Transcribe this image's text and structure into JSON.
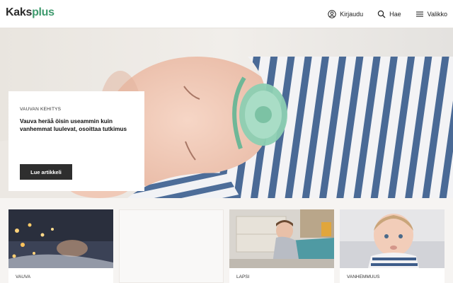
{
  "header": {
    "logo": {
      "part1": "Kaks",
      "part2": "plus"
    },
    "nav": {
      "login_label": "Kirjaudu",
      "search_label": "Hae",
      "menu_label": "Valikko"
    }
  },
  "hero": {
    "kicker": "VAUVAN KEHITYS",
    "title": "Vauva heräå öisin useammin kuin vanhemmat luulevat, osoittaa tutkimus",
    "button_label": "Lue artikkeli"
  },
  "cards": [
    {
      "category": "VAUVA"
    },
    {
      "category": ""
    },
    {
      "category": "LAPSI"
    },
    {
      "category": "VANHEMMUUS"
    }
  ],
  "colors": {
    "brand_green": "#3f9a6e",
    "button_dark": "#2e2e2e",
    "pacifier_mint": "#8ccfb2",
    "stripe_blue": "#4a6a96"
  }
}
